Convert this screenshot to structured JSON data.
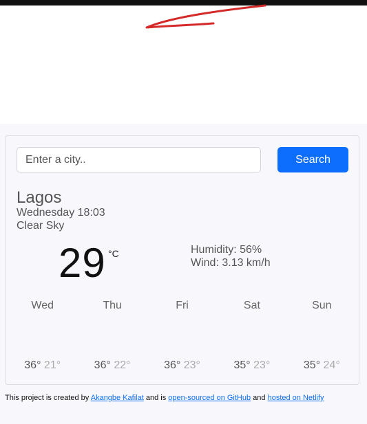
{
  "search": {
    "placeholder": "Enter a city..",
    "button_label": "Search"
  },
  "current": {
    "city": "Lagos",
    "datetime": "Wednesday 18:03",
    "description": "Clear Sky",
    "temperature": "29",
    "unit": "°C",
    "humidity": "Humidity: 56%",
    "wind": "Wind: 3.13 km/h"
  },
  "forecast": [
    {
      "day": "Wed",
      "max": "36°",
      "min": "21°"
    },
    {
      "day": "Thu",
      "max": "36°",
      "min": "22°"
    },
    {
      "day": "Fri",
      "max": "36°",
      "min": "23°"
    },
    {
      "day": "Sat",
      "max": "35°",
      "min": "23°"
    },
    {
      "day": "Sun",
      "max": "35°",
      "min": "24°"
    }
  ],
  "footer": {
    "text1": "This project is created by ",
    "author_link": "Akangbe Kafilat",
    "text2": " and is ",
    "github_link": "open-sourced on GitHub",
    "text3": " and ",
    "netlify_link": "hosted on Netlify"
  },
  "colors": {
    "accent": "#0d6efd",
    "scribble": "#d42a2a"
  }
}
